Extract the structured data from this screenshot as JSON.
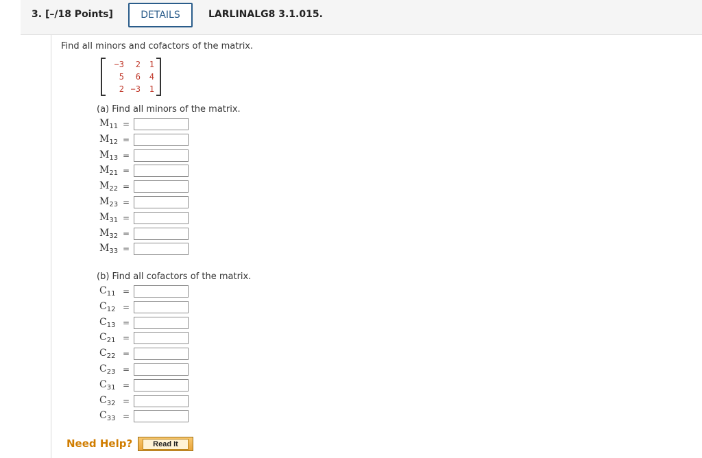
{
  "header": {
    "question_number": "3.",
    "points": "[–/18 Points]",
    "details_label": "DETAILS",
    "question_code": "LARLINALG8 3.1.015."
  },
  "prompt": "Find all minors and cofactors of the matrix.",
  "matrix": [
    [
      "−3",
      "2",
      "1"
    ],
    [
      "5",
      "6",
      "4"
    ],
    [
      "2",
      "−3",
      "1"
    ]
  ],
  "colors": {
    "matrix_entries": "#c0392b",
    "details_border": "#2a5c8a",
    "need_help": "#d07d00"
  },
  "part_a": {
    "label": "(a) Find all minors of the matrix.",
    "items": [
      {
        "letter": "M",
        "sub": "11",
        "eq": "=",
        "value": ""
      },
      {
        "letter": "M",
        "sub": "12",
        "eq": "=",
        "value": ""
      },
      {
        "letter": "M",
        "sub": "13",
        "eq": "=",
        "value": ""
      },
      {
        "letter": "M",
        "sub": "21",
        "eq": "=",
        "value": ""
      },
      {
        "letter": "M",
        "sub": "22",
        "eq": "=",
        "value": ""
      },
      {
        "letter": "M",
        "sub": "23",
        "eq": "=",
        "value": ""
      },
      {
        "letter": "M",
        "sub": "31",
        "eq": "=",
        "value": ""
      },
      {
        "letter": "M",
        "sub": "32",
        "eq": "=",
        "value": ""
      },
      {
        "letter": "M",
        "sub": "33",
        "eq": "=",
        "value": ""
      }
    ]
  },
  "part_b": {
    "label": "(b) Find all cofactors of the matrix.",
    "items": [
      {
        "letter": "C",
        "sub": "11",
        "eq": "=",
        "value": ""
      },
      {
        "letter": "C",
        "sub": "12",
        "eq": "=",
        "value": ""
      },
      {
        "letter": "C",
        "sub": "13",
        "eq": "=",
        "value": ""
      },
      {
        "letter": "C",
        "sub": "21",
        "eq": "=",
        "value": ""
      },
      {
        "letter": "C",
        "sub": "22",
        "eq": "=",
        "value": ""
      },
      {
        "letter": "C",
        "sub": "23",
        "eq": "=",
        "value": ""
      },
      {
        "letter": "C",
        "sub": "31",
        "eq": "=",
        "value": ""
      },
      {
        "letter": "C",
        "sub": "32",
        "eq": "=",
        "value": ""
      },
      {
        "letter": "C",
        "sub": "33",
        "eq": "=",
        "value": ""
      }
    ]
  },
  "help": {
    "need_help_label": "Need Help?",
    "read_it_label": "Read It"
  }
}
